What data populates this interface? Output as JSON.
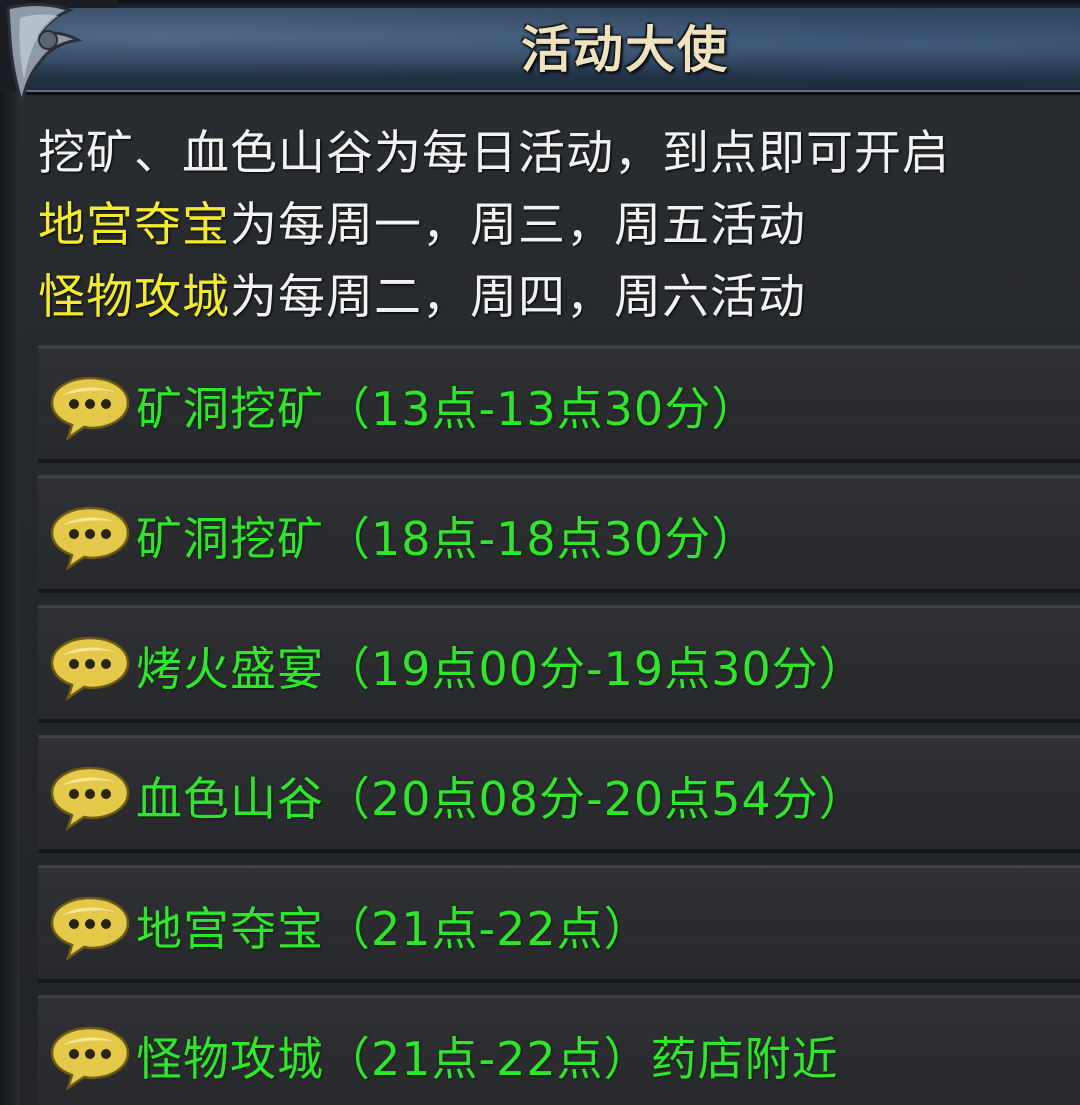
{
  "window": {
    "title": "活动大使"
  },
  "description": {
    "line1": "挖矿、血色山谷为每日活动，到点即可开启",
    "line2": {
      "highlight": "地宫夺宝",
      "rest": "为每周一，周三，周五活动"
    },
    "line3": {
      "highlight": "怪物攻城",
      "rest": "为每周二，周四，周六活动"
    }
  },
  "activities": [
    {
      "label": "矿洞挖矿（13点-13点30分）",
      "icon": "speech-bubble-icon"
    },
    {
      "label": "矿洞挖矿（18点-18点30分）",
      "icon": "speech-bubble-icon"
    },
    {
      "label": "烤火盛宴（19点00分-19点30分）",
      "icon": "speech-bubble-icon"
    },
    {
      "label": "血色山谷（20点08分-20点54分）",
      "icon": "speech-bubble-icon"
    },
    {
      "label": "地宫夺宝（21点-22点）",
      "icon": "speech-bubble-icon"
    },
    {
      "label": "怪物攻城（21点-22点）药店附近",
      "icon": "speech-bubble-icon"
    }
  ],
  "colors": {
    "activity_text": "#2ee62a",
    "highlight_text": "#f3ec2e",
    "title_text": "#efe3bd"
  }
}
